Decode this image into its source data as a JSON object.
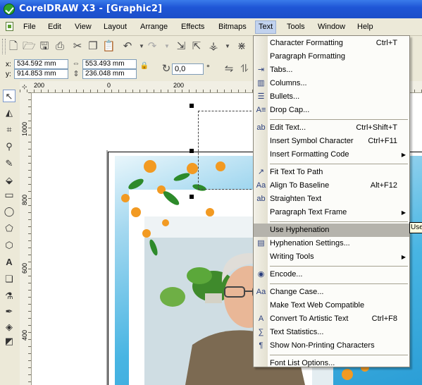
{
  "window": {
    "title": "CorelDRAW X3 - [Graphic2]"
  },
  "menubar": {
    "items": [
      {
        "label": "File",
        "underline": "F"
      },
      {
        "label": "Edit",
        "underline": "E"
      },
      {
        "label": "View",
        "underline": "V"
      },
      {
        "label": "Layout",
        "underline": "L"
      },
      {
        "label": "Arrange",
        "underline": "A"
      },
      {
        "label": "Effects",
        "underline": "C"
      },
      {
        "label": "Bitmaps",
        "underline": "B"
      },
      {
        "label": "Text",
        "underline": "T"
      },
      {
        "label": "Tools",
        "underline": "o"
      },
      {
        "label": "Window",
        "underline": "W"
      },
      {
        "label": "Help",
        "underline": "H"
      }
    ],
    "active": "Text"
  },
  "property_bar": {
    "x_label": "x:",
    "x_value": "534.592 mm",
    "y_label": "y:",
    "y_value": "914.853 mm",
    "width_value": "553.493 mm",
    "height_value": "236.048 mm",
    "rotation_value": "0,0",
    "rotation_unit": "°"
  },
  "rulers": {
    "horizontal": [
      "200",
      "0",
      "200"
    ],
    "vertical": [
      "1000",
      "800",
      "600",
      "400"
    ]
  },
  "text_menu": {
    "items": [
      {
        "type": "item",
        "label": "Character Formatting",
        "shortcut": "Ctrl+T",
        "icon": "character-formatting-icon"
      },
      {
        "type": "item",
        "label": "Paragraph Formatting",
        "shortcut": "",
        "icon": ""
      },
      {
        "type": "item",
        "label": "Tabs...",
        "shortcut": "",
        "icon": "tabs-icon"
      },
      {
        "type": "item",
        "label": "Columns...",
        "shortcut": "",
        "icon": "columns-icon"
      },
      {
        "type": "item",
        "label": "Bullets...",
        "shortcut": "",
        "icon": "bullets-icon"
      },
      {
        "type": "item",
        "label": "Drop Cap...",
        "shortcut": "",
        "icon": "drop-cap-icon"
      },
      {
        "type": "separator"
      },
      {
        "type": "item",
        "label": "Edit Text...",
        "shortcut": "Ctrl+Shift+T",
        "icon": "edit-text-icon"
      },
      {
        "type": "item",
        "label": "Insert Symbol Character",
        "shortcut": "Ctrl+F11",
        "icon": ""
      },
      {
        "type": "item",
        "label": "Insert Formatting Code",
        "shortcut": "",
        "icon": "",
        "submenu": true
      },
      {
        "type": "separator"
      },
      {
        "type": "item",
        "label": "Fit Text To Path",
        "shortcut": "",
        "icon": "fit-text-to-path-icon"
      },
      {
        "type": "item",
        "label": "Align To Baseline",
        "shortcut": "Alt+F12",
        "icon": "align-to-baseline-icon"
      },
      {
        "type": "item",
        "label": "Straighten Text",
        "shortcut": "",
        "icon": "straighten-text-icon"
      },
      {
        "type": "item",
        "label": "Paragraph Text Frame",
        "shortcut": "",
        "icon": "",
        "submenu": true
      },
      {
        "type": "separator"
      },
      {
        "type": "item",
        "label": "Use Hyphenation",
        "shortcut": "",
        "icon": "",
        "highlight": true
      },
      {
        "type": "item",
        "label": "Hyphenation Settings...",
        "shortcut": "",
        "icon": "hyphenation-settings-icon"
      },
      {
        "type": "item",
        "label": "Writing Tools",
        "shortcut": "",
        "icon": "",
        "submenu": true
      },
      {
        "type": "separator"
      },
      {
        "type": "item",
        "label": "Encode...",
        "shortcut": "",
        "icon": "encode-icon"
      },
      {
        "type": "separator"
      },
      {
        "type": "item",
        "label": "Change Case...",
        "shortcut": "",
        "icon": "change-case-icon"
      },
      {
        "type": "item",
        "label": "Make Text Web Compatible",
        "shortcut": "",
        "icon": ""
      },
      {
        "type": "item",
        "label": "Convert To Artistic Text",
        "shortcut": "Ctrl+F8",
        "icon": "convert-artistic-text-icon"
      },
      {
        "type": "item",
        "label": "Text Statistics...",
        "shortcut": "",
        "icon": "text-statistics-icon"
      },
      {
        "type": "item",
        "label": "Show Non-Printing Characters",
        "shortcut": "",
        "icon": "non-printing-characters-icon"
      },
      {
        "type": "separator"
      },
      {
        "type": "item",
        "label": "Font List Options...",
        "shortcut": "",
        "icon": ""
      }
    ]
  },
  "tooltip": {
    "text": "Use"
  }
}
